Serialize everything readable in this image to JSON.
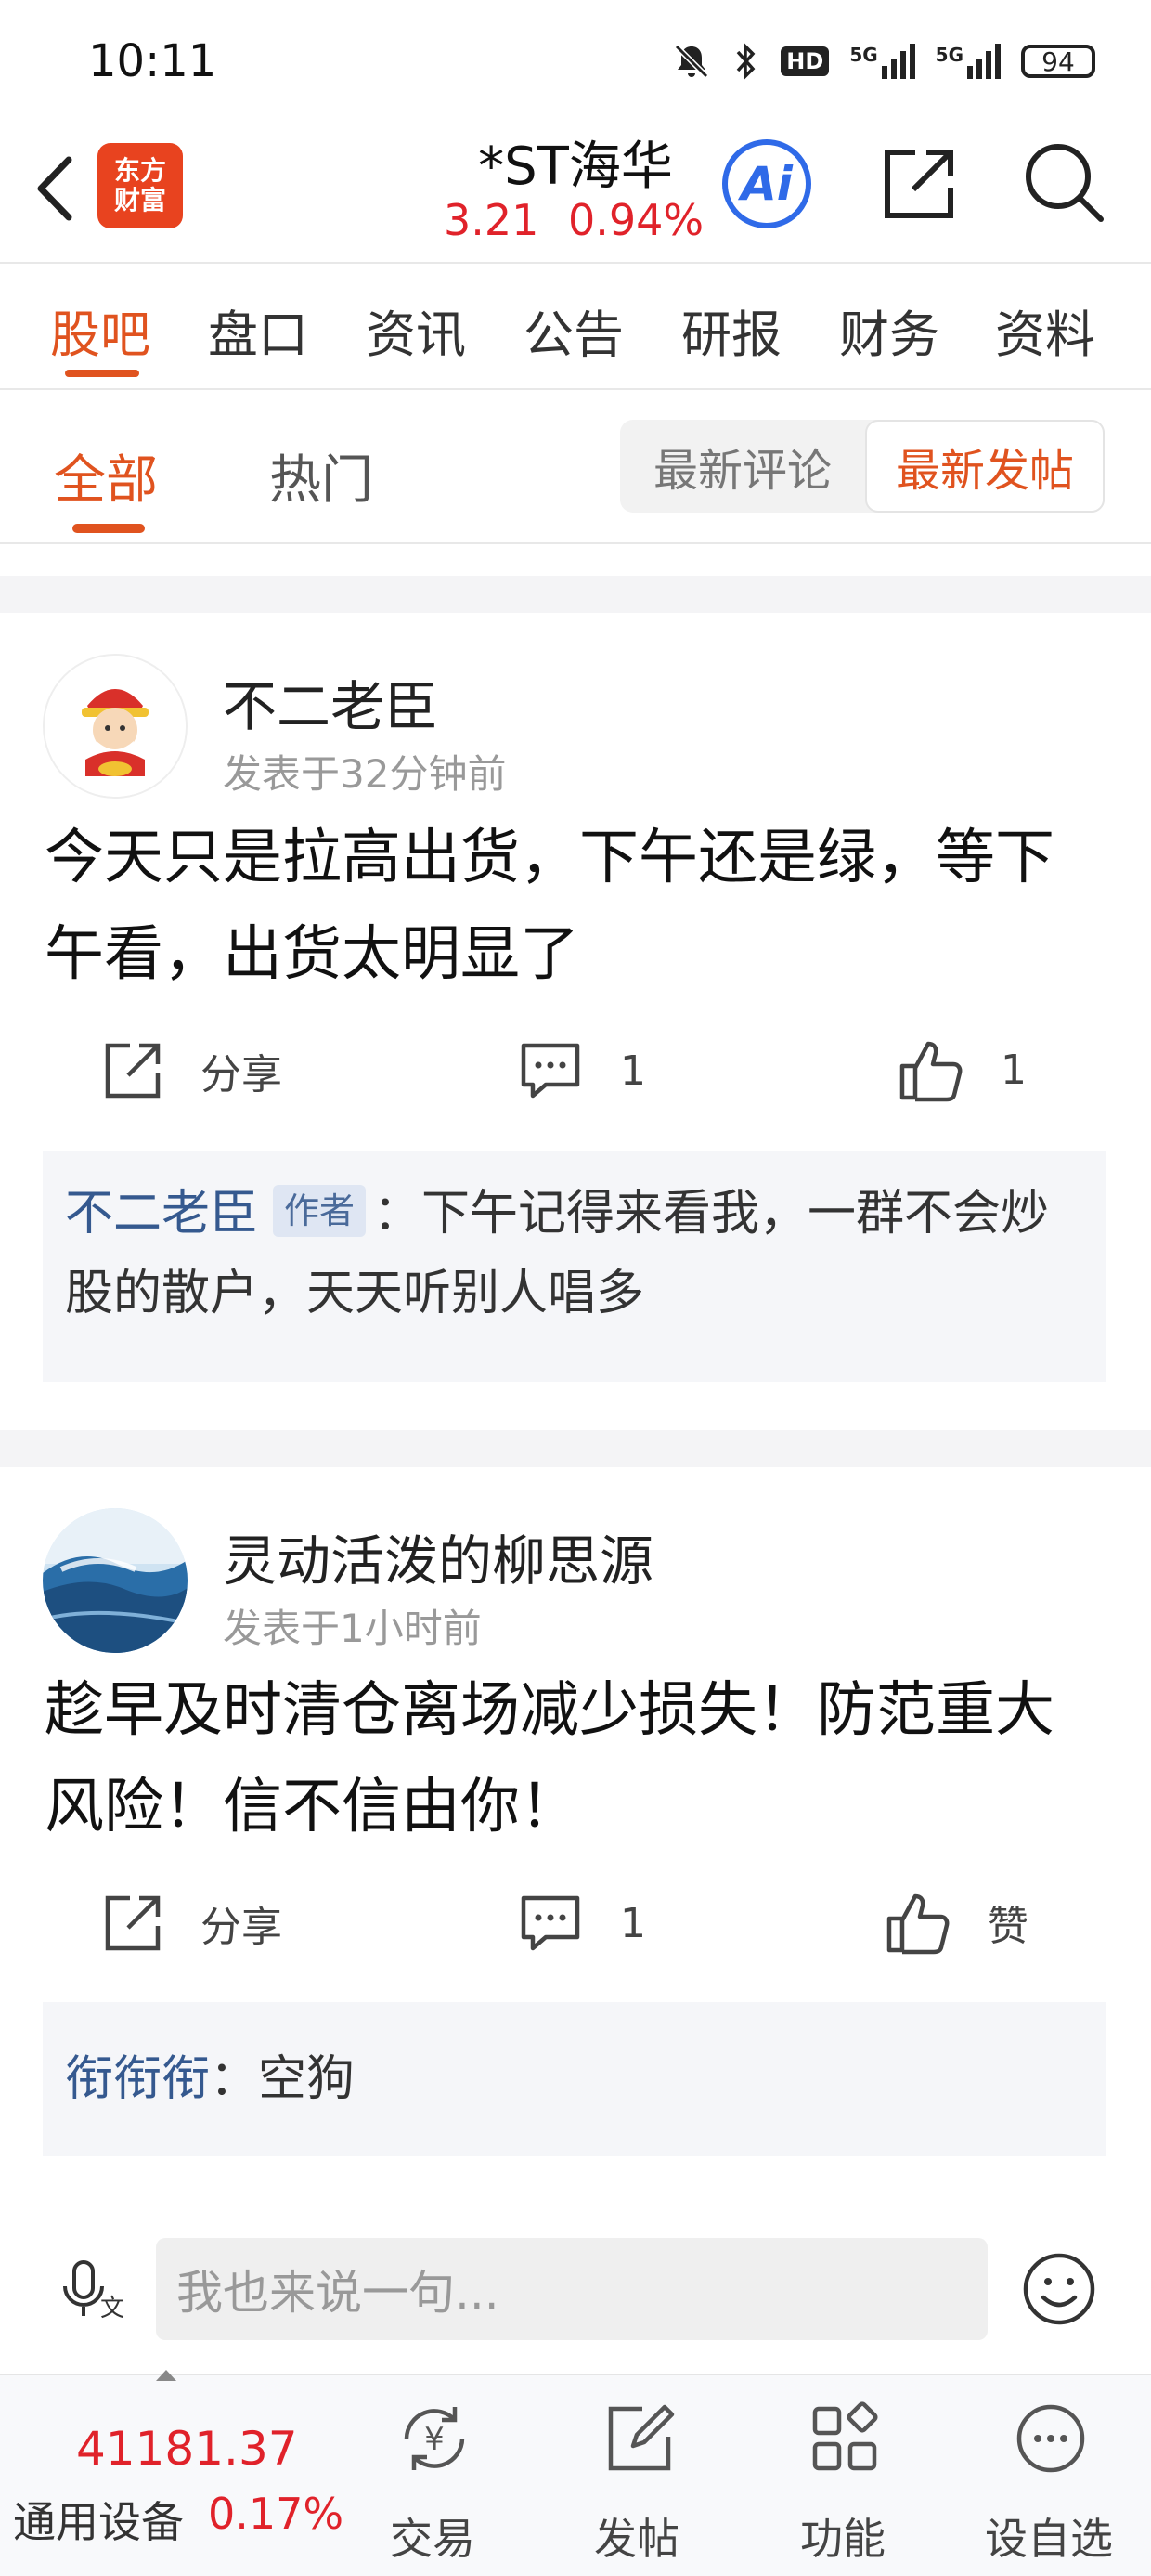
{
  "status_bar": {
    "time": "10:11",
    "signal_1": "5G",
    "signal_2": "5G",
    "hd_badge": "HD",
    "battery": "94"
  },
  "header": {
    "logo_line1": "东方",
    "logo_line2": "财富",
    "stock_name": "*ST海华",
    "price": "3.21",
    "change_pct": "0.94%",
    "ai_label": "Ai"
  },
  "main_tabs": [
    {
      "label": "股吧",
      "active": true
    },
    {
      "label": "盘口"
    },
    {
      "label": "资讯"
    },
    {
      "label": "公告"
    },
    {
      "label": "研报"
    },
    {
      "label": "财务"
    },
    {
      "label": "资料"
    }
  ],
  "sub_tabs": {
    "all": "全部",
    "hot": "热门",
    "sort_latest_comment": "最新评论",
    "sort_latest_post": "最新发帖"
  },
  "posts": [
    {
      "username": "不二老臣",
      "time": "发表于32分钟前",
      "body": "今天只是拉高出货，下午还是绿，等下午看，出货太明显了",
      "share_label": "分享",
      "comment_count": "1",
      "like_label": "1",
      "reply": {
        "name": "不二老臣",
        "tag": "作者",
        "text": "：下午记得来看我，一群不会炒股的散户，天天听别人唱多"
      }
    },
    {
      "username": "灵动活泼的柳思源",
      "time": "发表于1小时前",
      "body": "趁早及时清仓离场减少损失！防范重大风险！信不信由你！",
      "share_label": "分享",
      "comment_count": "1",
      "like_label": "赞",
      "reply": {
        "name": "衔衔衔",
        "text": "：空狗"
      }
    }
  ],
  "comment_bar": {
    "placeholder": "我也来说一句..."
  },
  "bottom_nav": {
    "index_value": "41181.37",
    "index_name": "通用设备",
    "index_change": "0.17%",
    "items": [
      {
        "label": "交易",
        "icon": "yuan-exchange-icon"
      },
      {
        "label": "发帖",
        "icon": "edit-post-icon"
      },
      {
        "label": "功能",
        "icon": "grid-apps-icon"
      },
      {
        "label": "设自选",
        "icon": "more-dots-icon"
      }
    ]
  },
  "colors": {
    "accent_orange": "#e0531f",
    "price_red": "#e0222a",
    "ai_blue": "#2f6ae8",
    "reply_name_blue": "#35598f"
  }
}
